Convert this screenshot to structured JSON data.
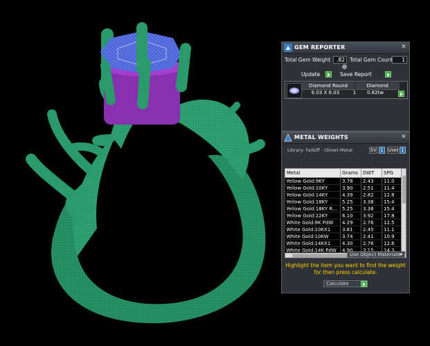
{
  "gem_reporter": {
    "title": "GEM REPORTER",
    "total_gem_weight_label": "Total Gem Weight",
    "total_gem_weight_value": ".82",
    "total_gem_count_label": "Total Gem Count",
    "total_gem_count_value": "1",
    "update_label": "Update",
    "save_report_label": "Save Report",
    "gem": {
      "shape": "Diamond Round",
      "material": "Diamond",
      "size": "6.03 X 6.03",
      "count": "1",
      "weight": "0.82tw"
    }
  },
  "metal_weights": {
    "title": "METAL WEIGHTS",
    "library_label": "Library: Failsiff - (Slow)-Metal",
    "sv_label": "SV",
    "user_label": "User",
    "columns": [
      "Metal",
      "Grams",
      "DWT",
      "SPG"
    ],
    "rows": [
      [
        "Yellow Gold:9KY",
        "3.78",
        "2.43",
        "11.0"
      ],
      [
        "Yellow Gold:10KY",
        "3.90",
        "2.51",
        "11.4"
      ],
      [
        "Yellow Gold:14KY",
        "4.39",
        "2.82",
        "12.8"
      ],
      [
        "Yellow Gold:18KY",
        "5.25",
        "3.38",
        "15.4"
      ],
      [
        "Yellow Gold:18KY R...",
        "5.25",
        "3.38",
        "15.4"
      ],
      [
        "Yellow Gold:22KY",
        "6.10",
        "3.92",
        "17.8"
      ],
      [
        "White Gold:9K PdW",
        "4.29",
        "2.76",
        "12.5"
      ],
      [
        "White Gold:10KX1",
        "3.81",
        "2.45",
        "11.1"
      ],
      [
        "White Gold:10KW",
        "3.74",
        "2.41",
        "10.9"
      ],
      [
        "White Gold:14KX1",
        "4.30",
        "2.76",
        "12.6"
      ],
      [
        "White Gold:14K PdW",
        "4.90",
        "3.15",
        "14.3"
      ]
    ],
    "use_object_materials": "Use Object Materials",
    "instruction": "Highlight the item you want to find the weight for then press calculate.",
    "calculate_label": "Calculate"
  },
  "colors": {
    "ring_green": "#2a9a6c",
    "gem_blue": "#4a63d8",
    "setting_purple": "#8a2bb0",
    "accent_green": "#3fa43f",
    "instruction_yellow": "#ffd400"
  }
}
